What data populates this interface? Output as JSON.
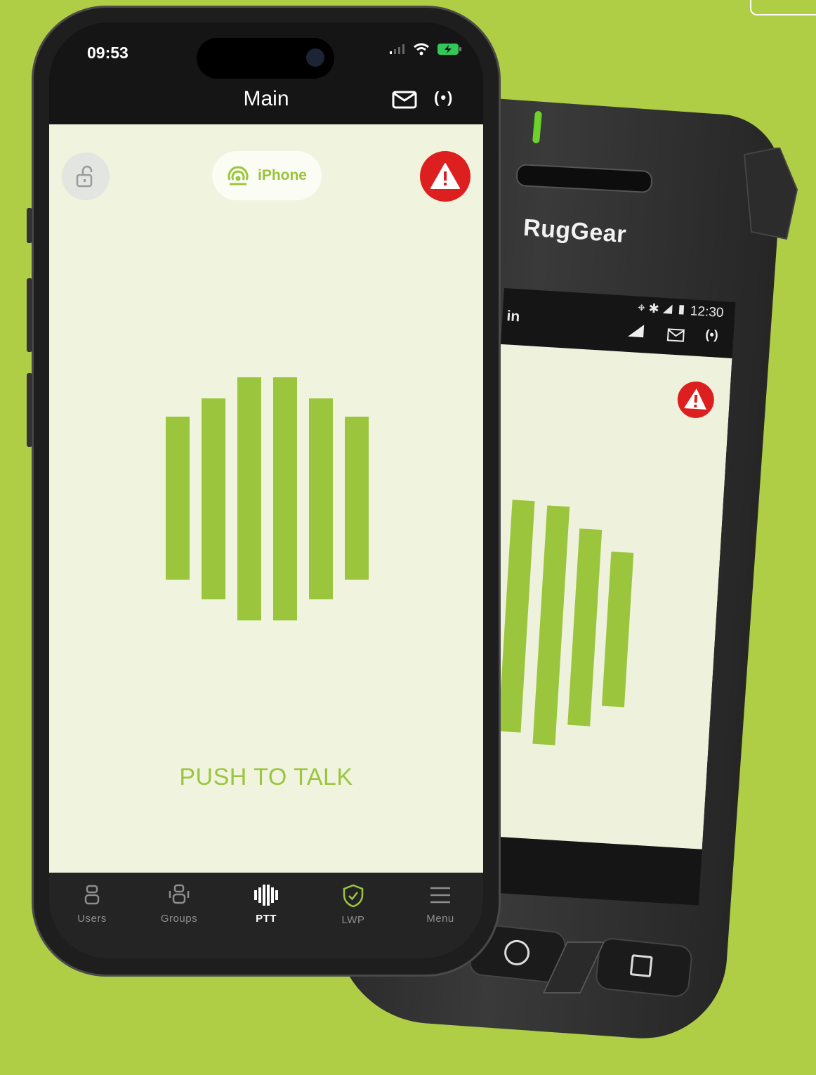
{
  "colors": {
    "background": "#afcd45",
    "accent": "#9cc53e",
    "alert": "#dd1f1f",
    "app_bg": "#f0f4de"
  },
  "iphone": {
    "status_time": "09:53",
    "header": {
      "title": "Main",
      "icons": [
        "mail-icon",
        "broadcast-icon"
      ],
      "signal_glyph": "(•)"
    },
    "device": {
      "label": "iPhone",
      "icon": "broadcast-icon"
    },
    "lock_icon": "unlock-icon",
    "alert_icon": "warning-icon",
    "ptt_label": "PUSH TO TALK",
    "tabs": [
      {
        "label": "Users",
        "icon": "users-icon",
        "active": false
      },
      {
        "label": "Groups",
        "icon": "groups-icon",
        "active": false
      },
      {
        "label": "PTT",
        "icon": "ptt-icon",
        "active": true
      },
      {
        "label": "LWP",
        "icon": "shield-check-icon",
        "active": false
      },
      {
        "label": "Menu",
        "icon": "menu-icon",
        "active": false
      }
    ]
  },
  "rugged_device": {
    "brand": "RugGear",
    "status_time": "12:30",
    "title_fragment": "in",
    "signal_glyph": "(•)"
  }
}
